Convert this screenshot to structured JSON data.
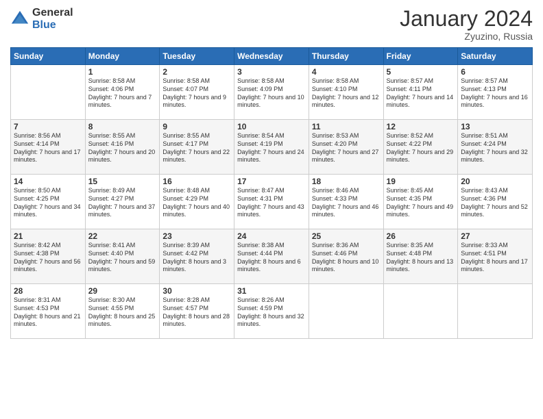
{
  "logo": {
    "general": "General",
    "blue": "Blue"
  },
  "header": {
    "month": "January 2024",
    "location": "Zyuzino, Russia"
  },
  "columns": [
    "Sunday",
    "Monday",
    "Tuesday",
    "Wednesday",
    "Thursday",
    "Friday",
    "Saturday"
  ],
  "weeks": [
    [
      {
        "day": "",
        "sunrise": "",
        "sunset": "",
        "daylight": ""
      },
      {
        "day": "1",
        "sunrise": "Sunrise: 8:58 AM",
        "sunset": "Sunset: 4:06 PM",
        "daylight": "Daylight: 7 hours and 7 minutes."
      },
      {
        "day": "2",
        "sunrise": "Sunrise: 8:58 AM",
        "sunset": "Sunset: 4:07 PM",
        "daylight": "Daylight: 7 hours and 9 minutes."
      },
      {
        "day": "3",
        "sunrise": "Sunrise: 8:58 AM",
        "sunset": "Sunset: 4:09 PM",
        "daylight": "Daylight: 7 hours and 10 minutes."
      },
      {
        "day": "4",
        "sunrise": "Sunrise: 8:58 AM",
        "sunset": "Sunset: 4:10 PM",
        "daylight": "Daylight: 7 hours and 12 minutes."
      },
      {
        "day": "5",
        "sunrise": "Sunrise: 8:57 AM",
        "sunset": "Sunset: 4:11 PM",
        "daylight": "Daylight: 7 hours and 14 minutes."
      },
      {
        "day": "6",
        "sunrise": "Sunrise: 8:57 AM",
        "sunset": "Sunset: 4:13 PM",
        "daylight": "Daylight: 7 hours and 16 minutes."
      }
    ],
    [
      {
        "day": "7",
        "sunrise": "Sunrise: 8:56 AM",
        "sunset": "Sunset: 4:14 PM",
        "daylight": "Daylight: 7 hours and 17 minutes."
      },
      {
        "day": "8",
        "sunrise": "Sunrise: 8:55 AM",
        "sunset": "Sunset: 4:16 PM",
        "daylight": "Daylight: 7 hours and 20 minutes."
      },
      {
        "day": "9",
        "sunrise": "Sunrise: 8:55 AM",
        "sunset": "Sunset: 4:17 PM",
        "daylight": "Daylight: 7 hours and 22 minutes."
      },
      {
        "day": "10",
        "sunrise": "Sunrise: 8:54 AM",
        "sunset": "Sunset: 4:19 PM",
        "daylight": "Daylight: 7 hours and 24 minutes."
      },
      {
        "day": "11",
        "sunrise": "Sunrise: 8:53 AM",
        "sunset": "Sunset: 4:20 PM",
        "daylight": "Daylight: 7 hours and 27 minutes."
      },
      {
        "day": "12",
        "sunrise": "Sunrise: 8:52 AM",
        "sunset": "Sunset: 4:22 PM",
        "daylight": "Daylight: 7 hours and 29 minutes."
      },
      {
        "day": "13",
        "sunrise": "Sunrise: 8:51 AM",
        "sunset": "Sunset: 4:24 PM",
        "daylight": "Daylight: 7 hours and 32 minutes."
      }
    ],
    [
      {
        "day": "14",
        "sunrise": "Sunrise: 8:50 AM",
        "sunset": "Sunset: 4:25 PM",
        "daylight": "Daylight: 7 hours and 34 minutes."
      },
      {
        "day": "15",
        "sunrise": "Sunrise: 8:49 AM",
        "sunset": "Sunset: 4:27 PM",
        "daylight": "Daylight: 7 hours and 37 minutes."
      },
      {
        "day": "16",
        "sunrise": "Sunrise: 8:48 AM",
        "sunset": "Sunset: 4:29 PM",
        "daylight": "Daylight: 7 hours and 40 minutes."
      },
      {
        "day": "17",
        "sunrise": "Sunrise: 8:47 AM",
        "sunset": "Sunset: 4:31 PM",
        "daylight": "Daylight: 7 hours and 43 minutes."
      },
      {
        "day": "18",
        "sunrise": "Sunrise: 8:46 AM",
        "sunset": "Sunset: 4:33 PM",
        "daylight": "Daylight: 7 hours and 46 minutes."
      },
      {
        "day": "19",
        "sunrise": "Sunrise: 8:45 AM",
        "sunset": "Sunset: 4:35 PM",
        "daylight": "Daylight: 7 hours and 49 minutes."
      },
      {
        "day": "20",
        "sunrise": "Sunrise: 8:43 AM",
        "sunset": "Sunset: 4:36 PM",
        "daylight": "Daylight: 7 hours and 52 minutes."
      }
    ],
    [
      {
        "day": "21",
        "sunrise": "Sunrise: 8:42 AM",
        "sunset": "Sunset: 4:38 PM",
        "daylight": "Daylight: 7 hours and 56 minutes."
      },
      {
        "day": "22",
        "sunrise": "Sunrise: 8:41 AM",
        "sunset": "Sunset: 4:40 PM",
        "daylight": "Daylight: 7 hours and 59 minutes."
      },
      {
        "day": "23",
        "sunrise": "Sunrise: 8:39 AM",
        "sunset": "Sunset: 4:42 PM",
        "daylight": "Daylight: 8 hours and 3 minutes."
      },
      {
        "day": "24",
        "sunrise": "Sunrise: 8:38 AM",
        "sunset": "Sunset: 4:44 PM",
        "daylight": "Daylight: 8 hours and 6 minutes."
      },
      {
        "day": "25",
        "sunrise": "Sunrise: 8:36 AM",
        "sunset": "Sunset: 4:46 PM",
        "daylight": "Daylight: 8 hours and 10 minutes."
      },
      {
        "day": "26",
        "sunrise": "Sunrise: 8:35 AM",
        "sunset": "Sunset: 4:48 PM",
        "daylight": "Daylight: 8 hours and 13 minutes."
      },
      {
        "day": "27",
        "sunrise": "Sunrise: 8:33 AM",
        "sunset": "Sunset: 4:51 PM",
        "daylight": "Daylight: 8 hours and 17 minutes."
      }
    ],
    [
      {
        "day": "28",
        "sunrise": "Sunrise: 8:31 AM",
        "sunset": "Sunset: 4:53 PM",
        "daylight": "Daylight: 8 hours and 21 minutes."
      },
      {
        "day": "29",
        "sunrise": "Sunrise: 8:30 AM",
        "sunset": "Sunset: 4:55 PM",
        "daylight": "Daylight: 8 hours and 25 minutes."
      },
      {
        "day": "30",
        "sunrise": "Sunrise: 8:28 AM",
        "sunset": "Sunset: 4:57 PM",
        "daylight": "Daylight: 8 hours and 28 minutes."
      },
      {
        "day": "31",
        "sunrise": "Sunrise: 8:26 AM",
        "sunset": "Sunset: 4:59 PM",
        "daylight": "Daylight: 8 hours and 32 minutes."
      },
      {
        "day": "",
        "sunrise": "",
        "sunset": "",
        "daylight": ""
      },
      {
        "day": "",
        "sunrise": "",
        "sunset": "",
        "daylight": ""
      },
      {
        "day": "",
        "sunrise": "",
        "sunset": "",
        "daylight": ""
      }
    ]
  ]
}
